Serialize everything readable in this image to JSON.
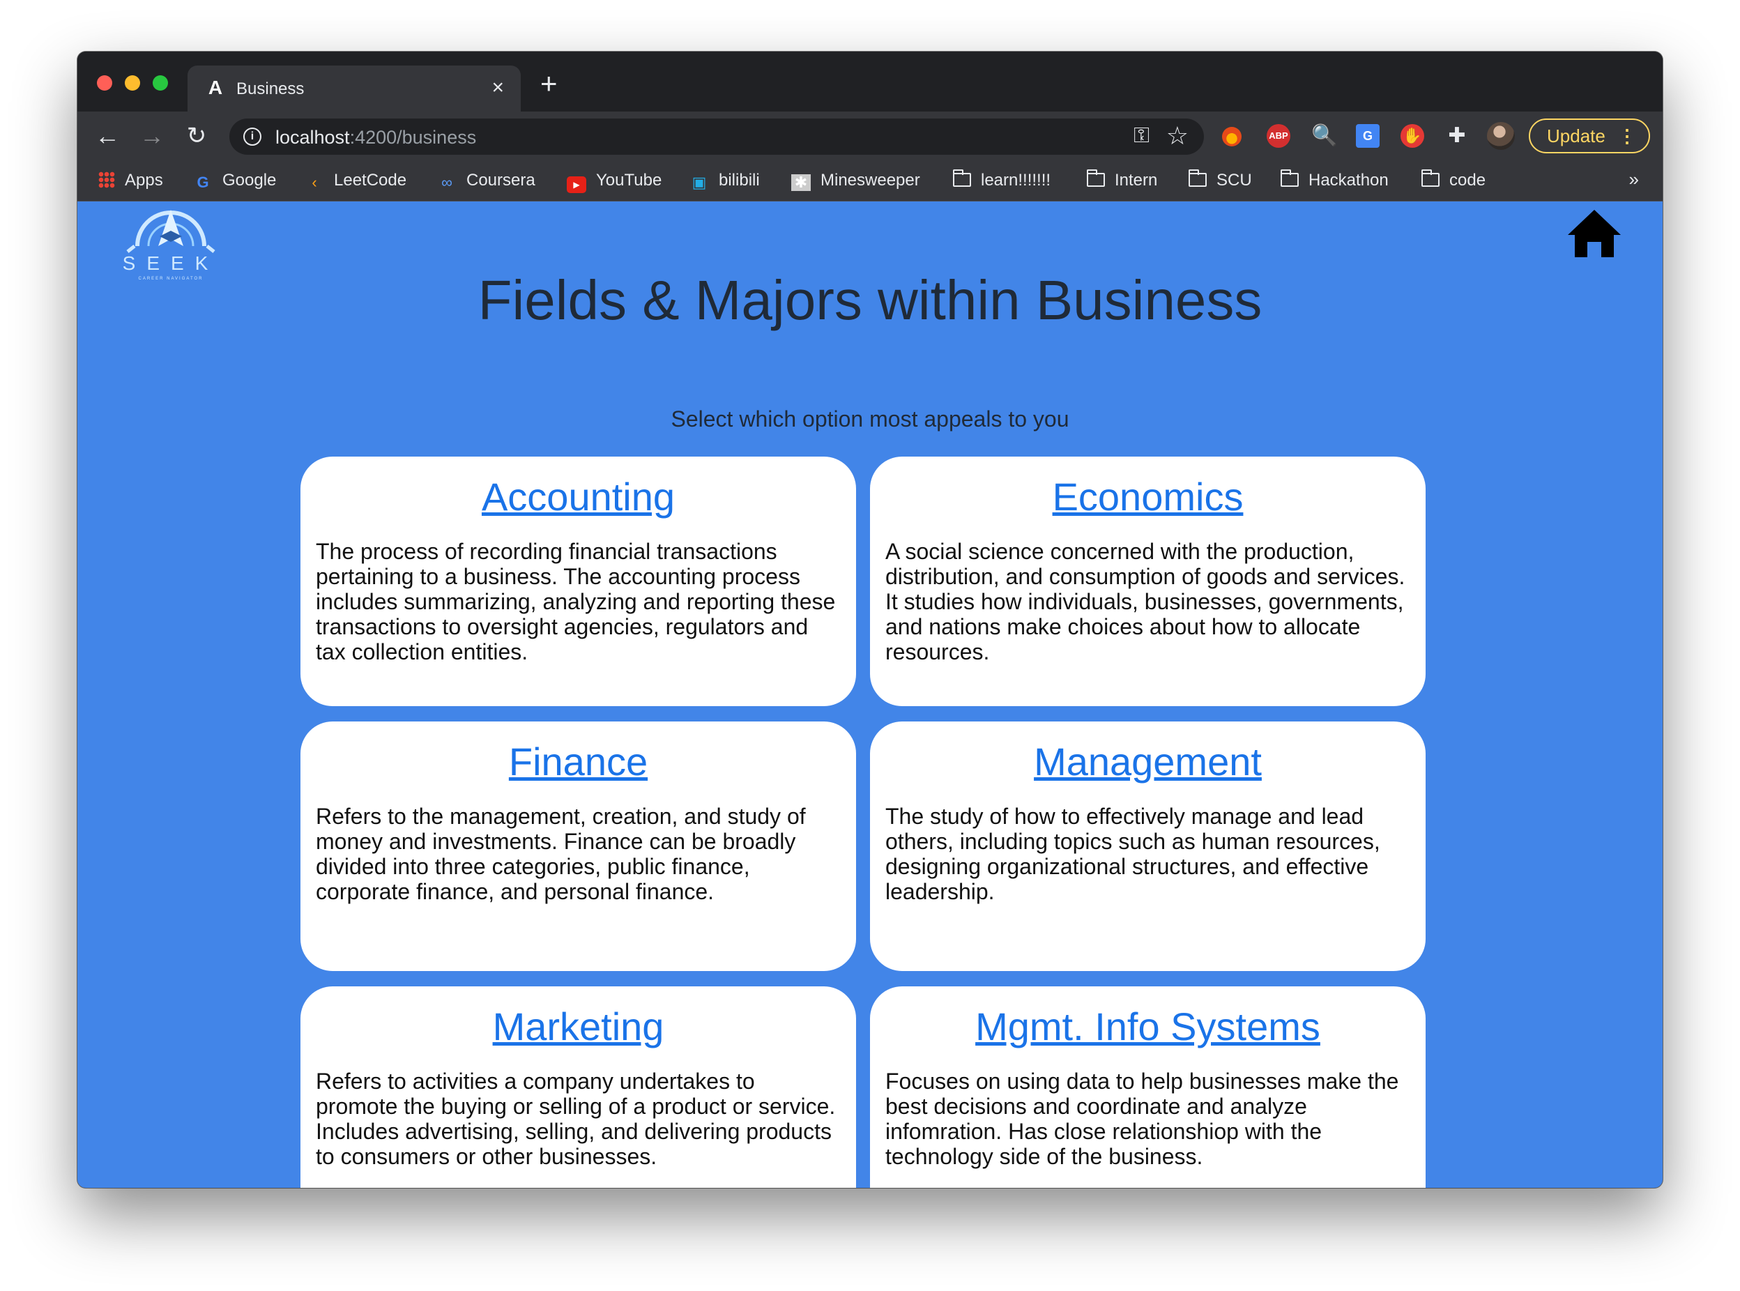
{
  "browser": {
    "tab_title": "Business",
    "url_host": "localhost",
    "url_path": ":4200/business",
    "update_label": "Update",
    "bookmarks": [
      {
        "label": "Apps",
        "icon": "apps-grid-icon"
      },
      {
        "label": "Google",
        "icon": "google-icon"
      },
      {
        "label": "LeetCode",
        "icon": "leetcode-icon"
      },
      {
        "label": "Coursera",
        "icon": "coursera-icon"
      },
      {
        "label": "YouTube",
        "icon": "youtube-icon"
      },
      {
        "label": "bilibili",
        "icon": "bilibili-icon"
      },
      {
        "label": "Minesweeper",
        "icon": "minesweeper-icon"
      },
      {
        "label": "learn!!!!!!!",
        "icon": "folder-icon"
      },
      {
        "label": "Intern",
        "icon": "folder-icon"
      },
      {
        "label": "SCU",
        "icon": "folder-icon"
      },
      {
        "label": "Hackathon",
        "icon": "folder-icon"
      },
      {
        "label": "code",
        "icon": "folder-icon"
      }
    ],
    "more_label": "»"
  },
  "page": {
    "logo_text": "SEEK",
    "logo_tagline": "CAREER NAVIGATOR",
    "title": "Fields & Majors within Business",
    "subtitle": "Select which option most appeals to you",
    "background_color": "#4285e8",
    "cards": [
      {
        "title": "Accounting",
        "description": "The process of recording financial transactions pertaining to a business. The accounting process includes summarizing, analyzing and reporting these transactions to oversight agencies, regulators and tax collection entities."
      },
      {
        "title": "Economics",
        "description": "A social science concerned with the production, distribution, and consumption of goods and services. It studies how individuals, businesses, governments, and nations make choices about how to allocate resources."
      },
      {
        "title": "Finance",
        "description": "Refers to the management, creation, and study of money and investments. Finance can be broadly divided into three categories, public finance, corporate finance, and personal finance."
      },
      {
        "title": "Management",
        "description": "The study of how to effectively manage and lead others, including topics such as human resources, designing organizational structures, and effective leadership."
      },
      {
        "title": "Marketing",
        "description": "Refers to activities a company undertakes to promote the buying or selling of a product or service. Includes advertising, selling, and delivering products to consumers or other businesses."
      },
      {
        "title": "Mgmt. Info Systems",
        "description": "Focuses on using data to help businesses make the best decisions and coordinate and analyze infomration. Has close relationshiop with the technology side of the business."
      }
    ]
  }
}
